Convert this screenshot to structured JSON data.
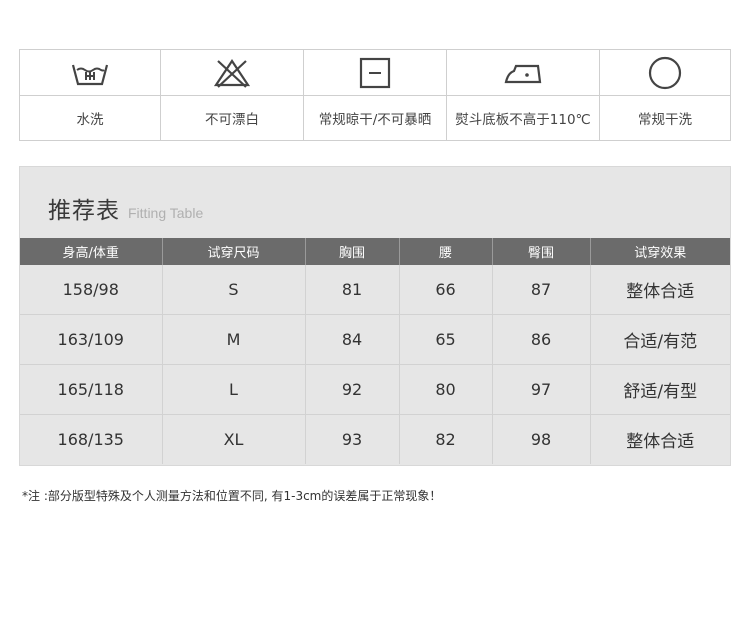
{
  "care_symbols": [
    {
      "icon": "wash-basin-icon",
      "label": "水洗"
    },
    {
      "icon": "do-not-bleach-icon",
      "label": "不可漂白"
    },
    {
      "icon": "line-dry-icon",
      "label": "常规晾干/不可暴晒"
    },
    {
      "icon": "iron-icon",
      "label": "熨斗底板不高于110℃"
    },
    {
      "icon": "dry-clean-icon",
      "label": "常规干洗"
    }
  ],
  "fitting": {
    "title_cn": "推荐表",
    "title_en": "Fitting Table",
    "headers": [
      "身高/体重",
      "试穿尺码",
      "胸围",
      "腰",
      "臀围",
      "试穿效果"
    ],
    "rows": [
      [
        "158/98",
        "S",
        "81",
        "66",
        "87",
        "整体合适"
      ],
      [
        "163/109",
        "M",
        "84",
        "65",
        "86",
        "合适/有范"
      ],
      [
        "165/118",
        "L",
        "92",
        "80",
        "97",
        "舒适/有型"
      ],
      [
        "168/135",
        "XL",
        "93",
        "82",
        "98",
        "整体合适"
      ]
    ]
  },
  "note": "*注 :部分版型特殊及个人测量方法和位置不同, 有1-3cm的误差属于正常现象！",
  "colors": {
    "header_bg": "#6b6b6b",
    "panel_bg": "#e6e6e6",
    "icon_stroke": "#444444"
  }
}
